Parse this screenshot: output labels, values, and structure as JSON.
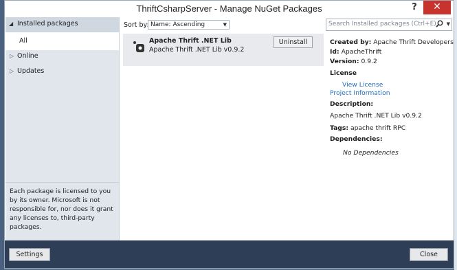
{
  "window": {
    "title": "ThriftCsharpServer - Manage NuGet Packages",
    "help_label": "?",
    "close_label": "✕"
  },
  "sidebar": {
    "installed": {
      "label": "Installed packages",
      "arrow": "◢"
    },
    "all": {
      "label": "All"
    },
    "items": [
      {
        "label": "Online",
        "arrow": "▷"
      },
      {
        "label": "Updates",
        "arrow": "▷"
      }
    ],
    "license_note": "Each package is licensed to you by its owner. Microsoft is not responsible for, nor does it grant any licenses to, third-party packages."
  },
  "toolbar": {
    "sort_label": "Sort by:",
    "sort_value": "Name: Ascending",
    "search_placeholder": "Search Installed packages (Ctrl+E)"
  },
  "package": {
    "name": "Apache Thrift .NET Lib",
    "description": "Apache Thrift .NET Lib v0.9.2",
    "uninstall_label": "Uninstall"
  },
  "details": {
    "created_by_label": "Created by:",
    "created_by": "Apache Thrift Developers",
    "id_label": "Id:",
    "id": "ApacheThrift",
    "version_label": "Version:",
    "version": "0.9.2",
    "license_label": "License",
    "view_license": "View License",
    "project_info": "Project Information",
    "description_label": "Description:",
    "description": "Apache Thrift .NET Lib v0.9.2",
    "tags_label": "Tags:",
    "tags": "apache thrift RPC",
    "dependencies_label": "Dependencies:",
    "no_dependencies": "No Dependencies"
  },
  "footer": {
    "settings_label": "Settings",
    "close_label": "Close"
  },
  "colors": {
    "footer_bg": "#2d3e56",
    "close_red": "#c7332d",
    "link_blue": "#1f6fbf"
  }
}
